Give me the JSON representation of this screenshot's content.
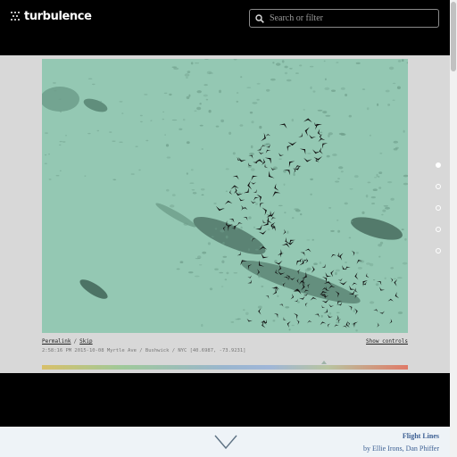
{
  "header": {
    "logo_text": "turbulence",
    "search_placeholder": "Search or filter"
  },
  "viewer": {
    "permalink_label": "Permalink",
    "separator": "/",
    "skip_label": "Skip",
    "controls_label": "Show controls",
    "meta": "2:58:16 PM 2015-10-08 Myrtle Ave / Bushwick / NYC [40.6987, -73.9231]",
    "timeline_position": 0.77
  },
  "pager": {
    "dot_count": 5,
    "active_index": 0
  },
  "next_post": {
    "title": "Flight Lines",
    "authors": "by Ellie Irons, Dan Phiffer"
  },
  "colors": {
    "canvas_bg": "#94c8b3",
    "accent_link": "#3c5f93",
    "bird": "#111111",
    "ghost": "#6f9e8b"
  }
}
